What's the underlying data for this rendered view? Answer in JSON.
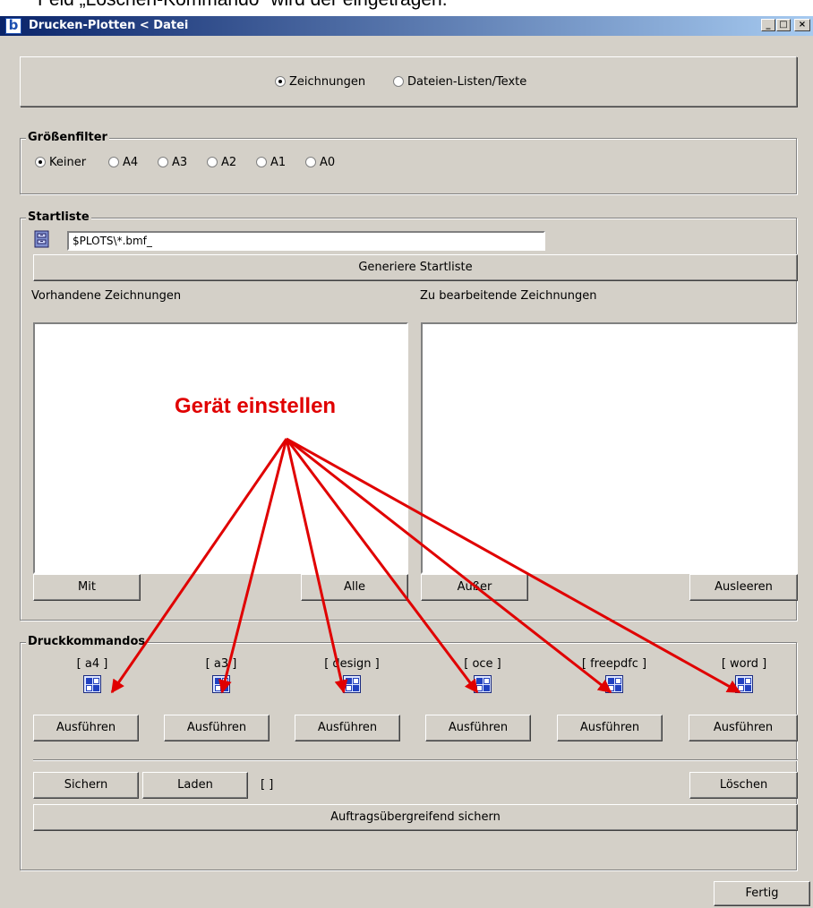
{
  "doc_fragment": "Feld „Löschen-Kommando“ wird der eingetragen.",
  "window": {
    "title": "Drucken-Plotten < Datei",
    "controls": [
      "_",
      "□",
      "×"
    ]
  },
  "mode": {
    "options": [
      "Zeichnungen",
      "Dateien-Listen/Texte"
    ],
    "selected": "Zeichnungen"
  },
  "size_filter": {
    "title": "Größenfilter",
    "options": [
      "Keiner",
      "A4",
      "A3",
      "A2",
      "A1",
      "A0"
    ],
    "selected": "Keiner"
  },
  "startlist": {
    "title": "Startliste",
    "path_value": "$PLOTS\\*.bmf_",
    "generate_label": "Generiere Startliste",
    "left_list_label": "Vorhandene Zeichnungen",
    "right_list_label": "Zu bearbeitende Zeichnungen",
    "buttons": {
      "mit": "Mit",
      "alle": "Alle",
      "ausser": "Außer",
      "ausleeren": "Ausleeren"
    }
  },
  "print_commands": {
    "title": "Druckkommandos",
    "commands": [
      {
        "label": "[ a4 ]",
        "run": "Ausführen"
      },
      {
        "label": "[ a3 ]",
        "run": "Ausführen"
      },
      {
        "label": "[ design ]",
        "run": "Ausführen"
      },
      {
        "label": "[ oce ]",
        "run": "Ausführen"
      },
      {
        "label": "[ freepdfc ]",
        "run": "Ausführen"
      },
      {
        "label": "[ word ]",
        "run": "Ausführen"
      }
    ],
    "save_label": "Sichern",
    "load_label": "Laden",
    "brackets": "[ ]",
    "delete_label": "Löschen",
    "global_save_label": "Auftragsübergreifend sichern"
  },
  "done_label": "Fertig",
  "annotation": {
    "text": "Gerät einstellen",
    "color": "#e00000"
  },
  "colors": {
    "window_bg": "#d4d0c8",
    "title_start": "#0a246a",
    "title_end": "#a6caf0",
    "arrow": "#e00000"
  }
}
